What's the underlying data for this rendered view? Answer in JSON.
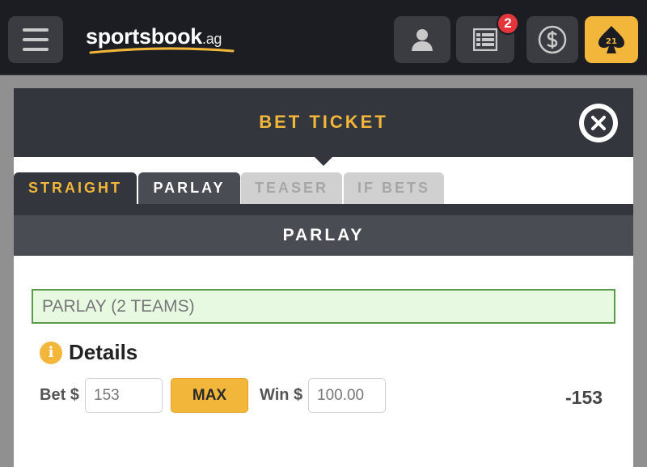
{
  "brand": {
    "logo_text": "sportsbook",
    "logo_suffix": ".ag",
    "accent_color": "#f2b73a"
  },
  "topnav": {
    "menu_icon": "hamburger-icon",
    "account_icon": "user-icon",
    "bets_icon": "list-icon",
    "bets_badge": "2",
    "cashier_icon": "dollar-coin-icon",
    "casino_icon": "spade-21-icon",
    "casino_label": "21"
  },
  "ticket": {
    "title": "BET TICKET",
    "close_icon": "close-circle-icon",
    "tabs": [
      {
        "label": "STRAIGHT",
        "state": "inactive"
      },
      {
        "label": "PARLAY",
        "state": "active"
      },
      {
        "label": "TEASER",
        "state": "disabled"
      },
      {
        "label": "IF BETS",
        "state": "disabled"
      }
    ],
    "section_title": "PARLAY",
    "parlay_label": "PARLAY (2 TEAMS)",
    "details": {
      "icon": "info-icon",
      "title": "Details",
      "bet_label": "Bet $",
      "bet_value": "153",
      "max_label": "MAX",
      "win_label": "Win $",
      "win_value": "100.00",
      "odds": "-153"
    }
  }
}
